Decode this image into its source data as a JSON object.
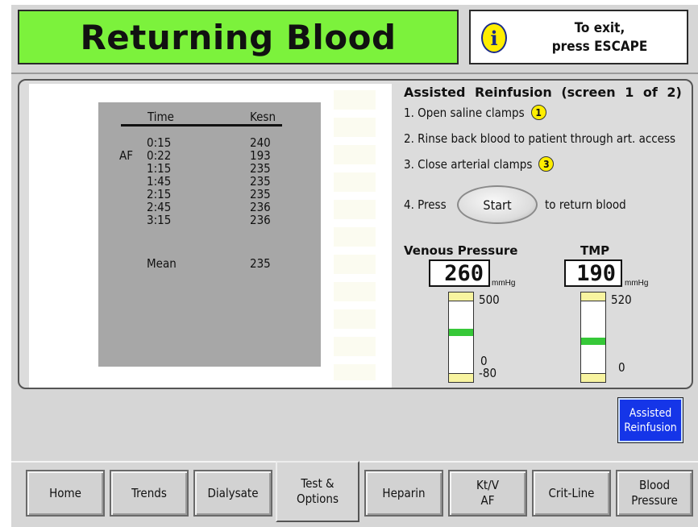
{
  "header": {
    "title": "Returning Blood",
    "exit_line1": "To exit,",
    "exit_line2": "press ESCAPE",
    "info_glyph": "i"
  },
  "table": {
    "col_time": "Time",
    "col_kesn": "Kesn",
    "af_label": "AF",
    "rows": [
      {
        "time": "0:15",
        "kesn": "240"
      },
      {
        "time": "0:22",
        "kesn": "193"
      },
      {
        "time": "1:15",
        "kesn": "235"
      },
      {
        "time": "1:45",
        "kesn": "235"
      },
      {
        "time": "2:15",
        "kesn": "235"
      },
      {
        "time": "2:45",
        "kesn": "236"
      },
      {
        "time": "3:15",
        "kesn": "236"
      }
    ],
    "mean_label": "Mean",
    "mean_value": "235"
  },
  "instructions": {
    "title": "Assisted Reinfusion (screen 1 of 2)",
    "step1": "1. Open saline clamps",
    "step1_badge": "1",
    "step2": "2. Rinse back blood to patient through art. access",
    "step3": "3. Close arterial clamps",
    "step3_badge": "3",
    "step4_prefix": "4. Press",
    "start_label": "Start",
    "step4_suffix": "to return blood"
  },
  "gauges": {
    "venous": {
      "label": "Venous Pressure",
      "value": "260",
      "unit": "mmHg",
      "max": "500",
      "zero": "0",
      "min": "-80"
    },
    "tmp": {
      "label": "TMP",
      "value": "190",
      "unit": "mmHg",
      "max": "520",
      "zero": "0"
    }
  },
  "side_button": {
    "line1": "Assisted",
    "line2": "Reinfusion"
  },
  "tabs": {
    "home": "Home",
    "trends": "Trends",
    "dialysate": "Dialysate",
    "test_l1": "Test &",
    "test_l2": "Options",
    "heparin": "Heparin",
    "ktv_l1": "Kt/V",
    "ktv_l2": "AF",
    "critline": "Crit-Line",
    "bp_l1": "Blood",
    "bp_l2": "Pressure"
  },
  "colors": {
    "title_bg": "#7cf23c",
    "accent_button": "#1535e8",
    "badge": "#ffee00",
    "gauge_green": "#36c838"
  }
}
